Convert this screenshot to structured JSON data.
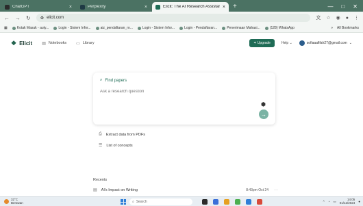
{
  "browser": {
    "tabs": [
      {
        "title": "ChatGPT",
        "favicon_color": "#2b2b2b",
        "active": false
      },
      {
        "title": "Perplexity",
        "favicon_color": "#1f3a44",
        "active": false
      },
      {
        "title": "Elicit: The AI Research Assistant",
        "favicon_color": "#1e6b55",
        "active": true
      }
    ],
    "tab_close_glyph": "×",
    "new_tab_glyph": "+",
    "window_controls": [
      "—",
      "□",
      "✕"
    ],
    "url": "elicit.com",
    "bookmarks": [
      "Kotak Masuk - auty...",
      "Login - Sistem Infor...",
      "aiz_pendaftaran_ro...",
      "Login - Sistem Infor...",
      "Login - Pendaftaran...",
      "Penerimaan Mahasi...",
      "(128) WhatsApp"
    ],
    "all_bookmarks": "All Bookmarks"
  },
  "app": {
    "logo": "Elicit",
    "nav": [
      {
        "label": "Notebooks",
        "icon": "notebook-icon"
      },
      {
        "label": "Library",
        "icon": "library-icon"
      }
    ],
    "upgrade_label": "✦ Upgrade",
    "help_label": "Help",
    "account_email": "sofiaaafifah27@gmail.com",
    "search": {
      "title": "Find papers",
      "placeholder": "Ask a research question"
    },
    "options": [
      {
        "label": "Extract data from PDFs",
        "icon": "extract-icon"
      },
      {
        "label": "List of concepts",
        "icon": "list-icon"
      }
    ],
    "recents_title": "Recents",
    "recents": [
      {
        "title": "AI's Impact on Writing",
        "time": "8:43pm Oct 24",
        "more": "···"
      }
    ]
  },
  "taskbar": {
    "weather_temp": "32°C",
    "weather_desc": "Berawan",
    "search_label": "Search",
    "clock_time": "14:05",
    "clock_date": "01/12/2024",
    "app_colors": [
      "#2b2b2b",
      "#3a6fd8",
      "#e6a021",
      "#4caf50",
      "#2f7fd8",
      "#d84a3a"
    ]
  },
  "colors": {
    "accent": "#1e6b55",
    "browser_frame": "#4b7263"
  }
}
